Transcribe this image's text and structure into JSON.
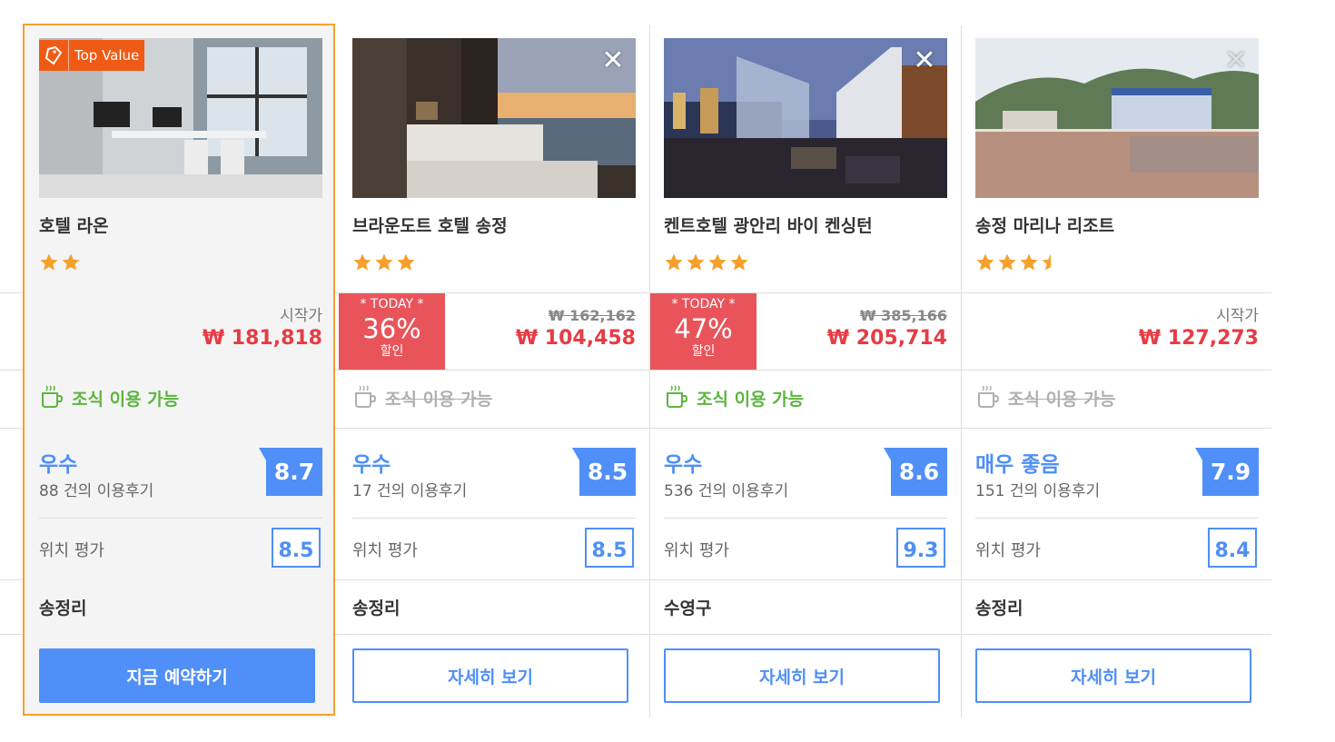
{
  "colors": {
    "accent_blue": "#4f8ff7",
    "price_red": "#e63c44",
    "highlight_border": "#f5a02c",
    "breakfast_green": "#5cb53f",
    "star_orange": "#f5a02c",
    "today_red": "#e9545b"
  },
  "hotels": [
    {
      "badge": "Top Value",
      "name": "호텔 라온",
      "stars": 2,
      "price_label": "시작가",
      "price": "₩ 181,818",
      "breakfast": "조식 이용 가능",
      "breakfast_available": true,
      "rating_word": "우수",
      "reviews": "88 건의 이용후기",
      "score": "8.7",
      "location_label": "위치 평가",
      "location_score": "8.5",
      "district": "송정리",
      "button": "지금 예약하기"
    },
    {
      "name": "브라운도트 호텔 송정",
      "stars": 3,
      "today_label": "* TODAY *",
      "discount": "36%",
      "discount_label": "할인",
      "old_price": "₩ 162,162",
      "price": "₩ 104,458",
      "breakfast": "조식 이용 가능",
      "breakfast_available": false,
      "rating_word": "우수",
      "reviews": "17 건의 이용후기",
      "score": "8.5",
      "location_label": "위치 평가",
      "location_score": "8.5",
      "district": "송정리",
      "button": "자세히 보기"
    },
    {
      "name": "켄트호텔 광안리 바이 켄싱턴",
      "stars": 4,
      "today_label": "* TODAY *",
      "discount": "47%",
      "discount_label": "할인",
      "old_price": "₩ 385,166",
      "price": "₩ 205,714",
      "breakfast": "조식 이용 가능",
      "breakfast_available": true,
      "rating_word": "우수",
      "reviews": "536 건의 이용후기",
      "score": "8.6",
      "location_label": "위치 평가",
      "location_score": "9.3",
      "district": "수영구",
      "button": "자세히 보기"
    },
    {
      "name": "송정 마리나 리조트",
      "stars": 3.5,
      "price_label": "시작가",
      "price": "₩ 127,273",
      "breakfast": "조식 이용 가능",
      "breakfast_available": false,
      "rating_word": "매우 좋음",
      "reviews": "151 건의 이용후기",
      "score": "7.9",
      "location_label": "위치 평가",
      "location_score": "8.4",
      "district": "송정리",
      "button": "자세히 보기"
    }
  ]
}
